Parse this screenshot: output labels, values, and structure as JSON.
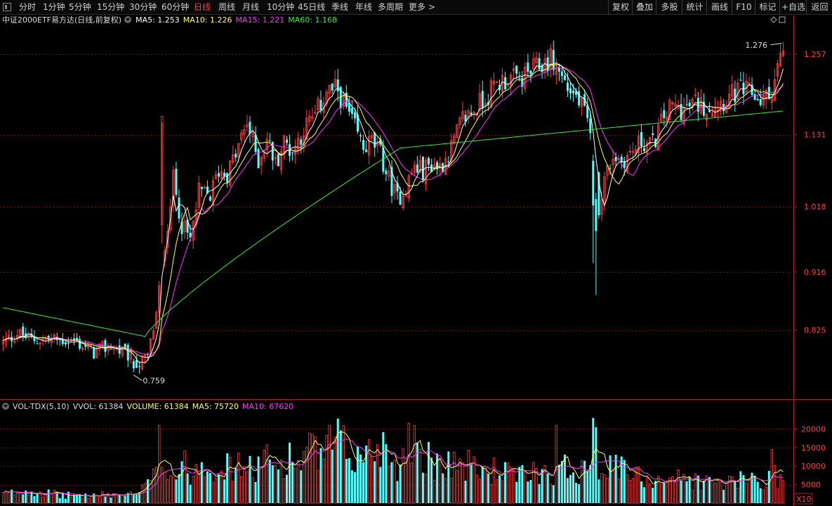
{
  "toolbar": {
    "periods": [
      "分时",
      "1分钟",
      "5分钟",
      "15分钟",
      "30分钟",
      "60分钟",
      "日线",
      "周线",
      "月线",
      "10分钟",
      "45日线",
      "季线",
      "年线",
      "多周期",
      "更多 >"
    ],
    "active_index": 6,
    "right_buttons": [
      "复权",
      "叠加",
      "多股",
      "统计",
      "画线",
      "F10",
      "标记",
      "+自选",
      "返回"
    ]
  },
  "price_header": {
    "title": "中证2000ETF易方达(日线,前复权)",
    "ma5": "MA5: 1.253",
    "ma10": "MA10: 1.226",
    "ma15": "MA15: 1.221",
    "ma60": "MA60: 1.168"
  },
  "vol_header": {
    "name": "VOL-TDX(5,10)",
    "vvol": "VVOL: 61384",
    "volume": "VOLUME: 61384",
    "ma5": "MA5: 75720",
    "ma10": "MA10: 67620"
  },
  "colors": {
    "up": "#ff3d3d",
    "down": "#54ffff",
    "ma5": "#ffffff",
    "ma10": "#ffff55",
    "ma15": "#ff33ff",
    "ma60": "#33ee33",
    "grid": "#6a0f0f",
    "axis": "#b02020"
  },
  "chart_data": {
    "type": "candlestick",
    "price_axis_ticks": [
      "1.257",
      "1.131",
      "1.018",
      "0.916",
      "0.825"
    ],
    "volume_axis_ticks": [
      "20000",
      "15000",
      "10000",
      "5000"
    ],
    "volume_axis_unit": "X10",
    "high_label": "1.276",
    "low_label": "0.759",
    "waypoints": [
      [
        0,
        0.805
      ],
      [
        5,
        0.82
      ],
      [
        10,
        0.81
      ],
      [
        18,
        0.81
      ],
      [
        25,
        0.808
      ],
      [
        32,
        0.79
      ],
      [
        38,
        0.8
      ],
      [
        44,
        0.785
      ],
      [
        48,
        0.772
      ],
      [
        51,
        0.782
      ],
      [
        54,
        0.85
      ],
      [
        57,
        0.96
      ],
      [
        60,
        1.06
      ],
      [
        63,
        0.99
      ],
      [
        66,
        0.965
      ],
      [
        69,
        1.04
      ],
      [
        73,
        1.035
      ],
      [
        76,
        1.075
      ],
      [
        79,
        1.07
      ],
      [
        82,
        1.1
      ],
      [
        86,
        1.15
      ],
      [
        90,
        1.09
      ],
      [
        93,
        1.125
      ],
      [
        96,
        1.085
      ],
      [
        99,
        1.12
      ],
      [
        102,
        1.105
      ],
      [
        106,
        1.14
      ],
      [
        110,
        1.16
      ],
      [
        114,
        1.2
      ],
      [
        118,
        1.2
      ],
      [
        121,
        1.17
      ],
      [
        124,
        1.14
      ],
      [
        127,
        1.11
      ],
      [
        130,
        1.12
      ],
      [
        133,
        1.1
      ],
      [
        136,
        1.06
      ],
      [
        139,
        1.03
      ],
      [
        142,
        1.05
      ],
      [
        145,
        1.08
      ],
      [
        148,
        1.075
      ],
      [
        151,
        1.085
      ],
      [
        154,
        1.08
      ],
      [
        158,
        1.11
      ],
      [
        162,
        1.155
      ],
      [
        166,
        1.17
      ],
      [
        170,
        1.19
      ],
      [
        174,
        1.21
      ],
      [
        178,
        1.22
      ],
      [
        182,
        1.215
      ],
      [
        186,
        1.23
      ],
      [
        190,
        1.24
      ],
      [
        193,
        1.25
      ],
      [
        196,
        1.23
      ],
      [
        199,
        1.205
      ],
      [
        202,
        1.19
      ],
      [
        205,
        1.165
      ],
      [
        208,
        1.1
      ],
      [
        210,
        1.02
      ],
      [
        212,
        1.06
      ],
      [
        215,
        1.1
      ],
      [
        218,
        1.09
      ],
      [
        221,
        1.1
      ],
      [
        225,
        1.12
      ],
      [
        229,
        1.115
      ],
      [
        233,
        1.16
      ],
      [
        236,
        1.175
      ],
      [
        240,
        1.17
      ],
      [
        244,
        1.18
      ],
      [
        248,
        1.175
      ],
      [
        252,
        1.18
      ],
      [
        256,
        1.19
      ],
      [
        260,
        1.2
      ],
      [
        264,
        1.195
      ],
      [
        267,
        1.185
      ],
      [
        270,
        1.19
      ],
      [
        272,
        1.22
      ],
      [
        274,
        1.25
      ],
      [
        275,
        1.262
      ]
    ],
    "volume_waypoints": [
      [
        0,
        2500
      ],
      [
        10,
        3500
      ],
      [
        20,
        2200
      ],
      [
        30,
        2000
      ],
      [
        40,
        2400
      ],
      [
        47,
        2200
      ],
      [
        51,
        5000
      ],
      [
        53,
        11000
      ],
      [
        55,
        14000
      ],
      [
        57,
        9000
      ],
      [
        60,
        7000
      ],
      [
        63,
        10500
      ],
      [
        67,
        8000
      ],
      [
        70,
        12000
      ],
      [
        74,
        9500
      ],
      [
        77,
        11000
      ],
      [
        80,
        9000
      ],
      [
        84,
        10500
      ],
      [
        88,
        8500
      ],
      [
        92,
        12000
      ],
      [
        96,
        9500
      ],
      [
        100,
        12500
      ],
      [
        104,
        11000
      ],
      [
        108,
        14000
      ],
      [
        112,
        12500
      ],
      [
        115,
        13500
      ],
      [
        118,
        16500
      ],
      [
        122,
        13000
      ],
      [
        126,
        12000
      ],
      [
        130,
        14500
      ],
      [
        134,
        16000
      ],
      [
        137,
        12000
      ],
      [
        140,
        10000
      ],
      [
        143,
        13500
      ],
      [
        146,
        15000
      ],
      [
        149,
        13000
      ],
      [
        152,
        10500
      ],
      [
        155,
        12500
      ],
      [
        158,
        11000
      ],
      [
        162,
        10500
      ],
      [
        166,
        9500
      ],
      [
        170,
        8500
      ],
      [
        174,
        9000
      ],
      [
        178,
        8000
      ],
      [
        182,
        7000
      ],
      [
        186,
        8500
      ],
      [
        190,
        9000
      ],
      [
        194,
        8500
      ],
      [
        198,
        9500
      ],
      [
        202,
        8500
      ],
      [
        205,
        11000
      ],
      [
        208,
        14500
      ],
      [
        210,
        10500
      ],
      [
        213,
        9000
      ],
      [
        217,
        10000
      ],
      [
        221,
        7500
      ],
      [
        225,
        7000
      ],
      [
        230,
        6500
      ],
      [
        235,
        7000
      ],
      [
        240,
        6500
      ],
      [
        245,
        6000
      ],
      [
        250,
        5500
      ],
      [
        255,
        5500
      ],
      [
        260,
        6000
      ],
      [
        264,
        7000
      ],
      [
        268,
        5500
      ],
      [
        272,
        8000
      ],
      [
        274,
        6500
      ],
      [
        275,
        6100
      ]
    ],
    "series": [
      "MA5",
      "MA10",
      "MA15",
      "MA60"
    ]
  }
}
